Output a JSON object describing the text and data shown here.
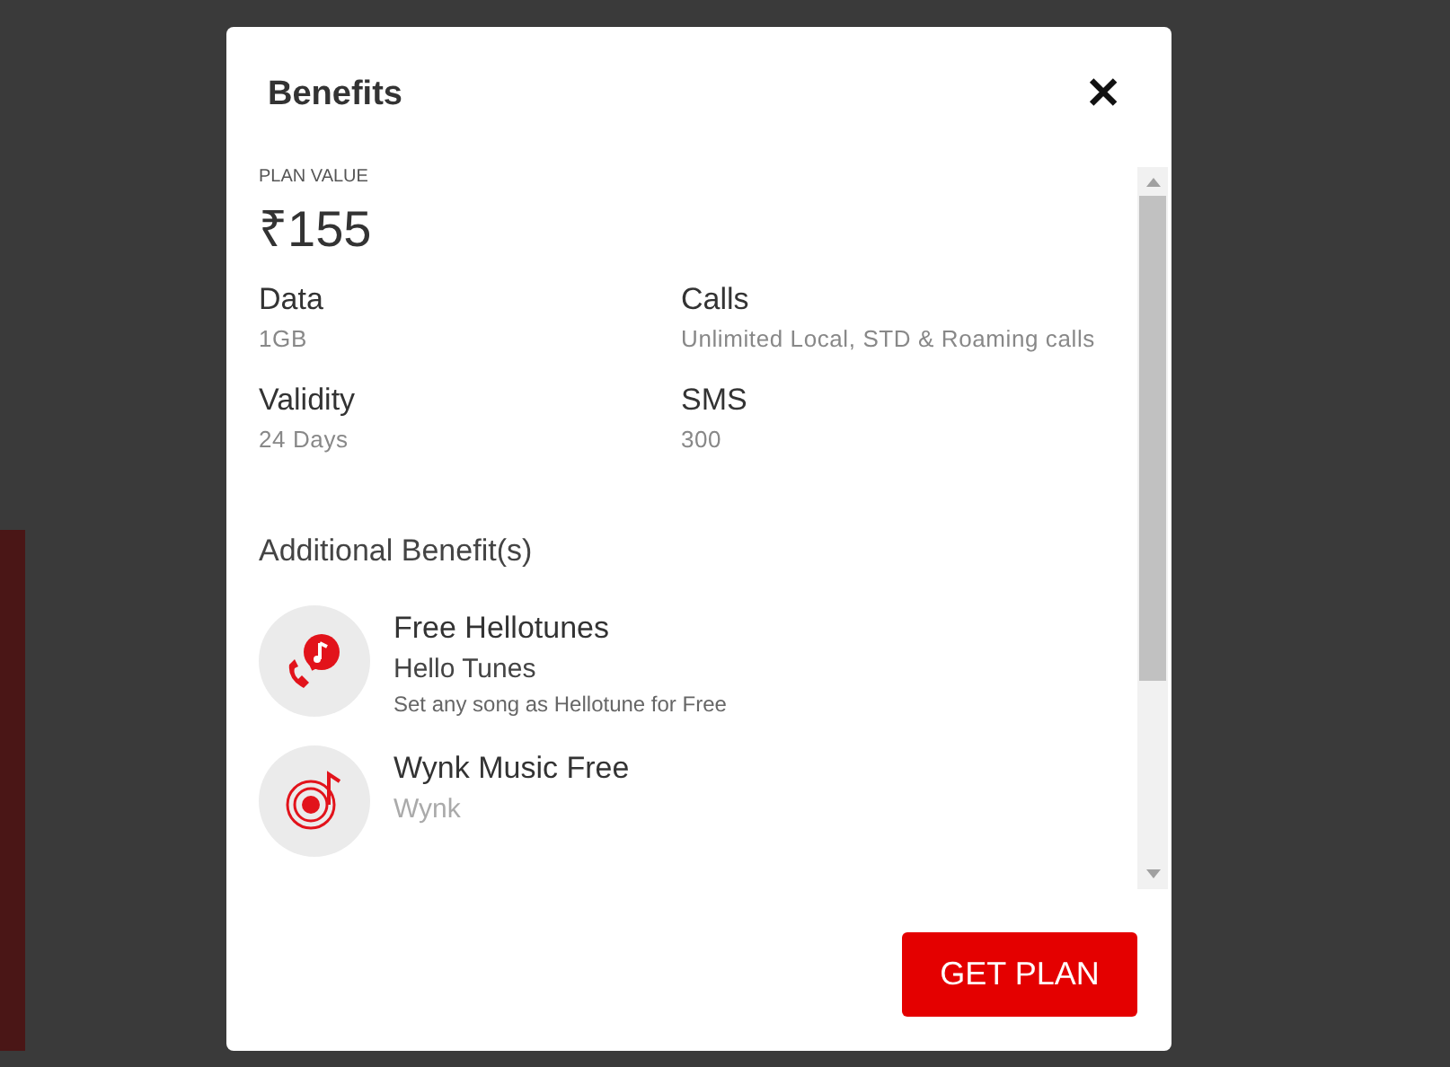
{
  "dialog": {
    "title": "Benefits",
    "close": "✕"
  },
  "plan": {
    "label": "PLAN VALUE",
    "price": "₹155"
  },
  "details": [
    {
      "label": "Data",
      "value": "1GB"
    },
    {
      "label": "Calls",
      "value": "Unlimited Local, STD & Roaming calls"
    },
    {
      "label": "Validity",
      "value": "24 Days"
    },
    {
      "label": "SMS",
      "value": "300"
    }
  ],
  "additional": {
    "heading": "Additional Benefit(s)",
    "items": [
      {
        "kind": "hellotune",
        "title": "Free Hellotunes",
        "subtitle": "Hello Tunes",
        "description": "Set any song as Hellotune for Free"
      },
      {
        "kind": "wynk",
        "title": "Wynk Music Free",
        "subtitle": "Wynk"
      }
    ]
  },
  "button": "GET PLAN"
}
